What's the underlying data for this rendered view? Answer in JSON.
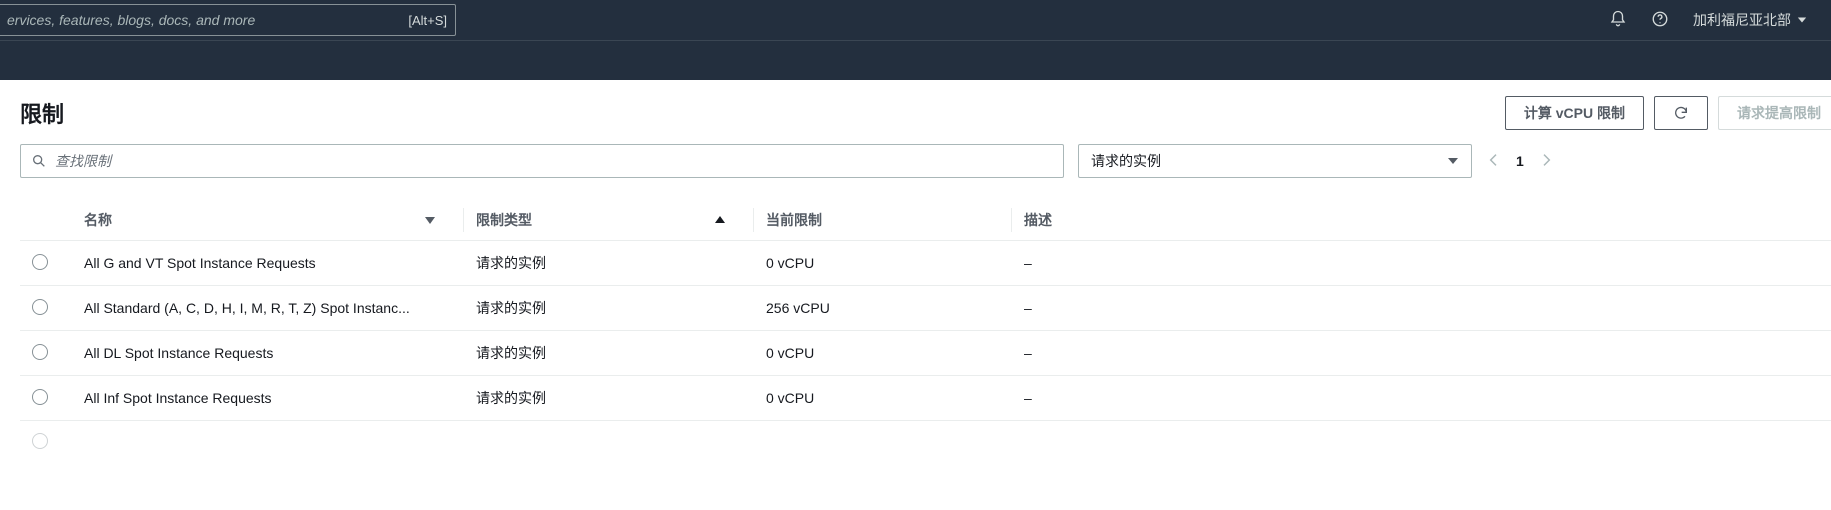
{
  "topbar": {
    "search_placeholder": "ervices, features, blogs, docs, and more",
    "search_shortcut": "[Alt+S]",
    "region": "加利福尼亚北部"
  },
  "page": {
    "title": "限制",
    "btn_compute": "计算 vCPU 限制",
    "btn_request_increase": "请求提高限制"
  },
  "filter": {
    "search_placeholder": "查找限制",
    "select_value": "请求的实例",
    "page_number": "1"
  },
  "columns": {
    "name": "名称",
    "type": "限制类型",
    "current": "当前限制",
    "desc": "描述"
  },
  "rows": [
    {
      "name": "All G and VT Spot Instance Requests",
      "type": "请求的实例",
      "current": "0 vCPU",
      "desc": "–"
    },
    {
      "name": "All Standard (A, C, D, H, I, M, R, T, Z) Spot Instanc...",
      "type": "请求的实例",
      "current": "256 vCPU",
      "desc": "–"
    },
    {
      "name": "All DL Spot Instance Requests",
      "type": "请求的实例",
      "current": "0 vCPU",
      "desc": "–"
    },
    {
      "name": "All Inf Spot Instance Requests",
      "type": "请求的实例",
      "current": "0 vCPU",
      "desc": "–"
    }
  ]
}
